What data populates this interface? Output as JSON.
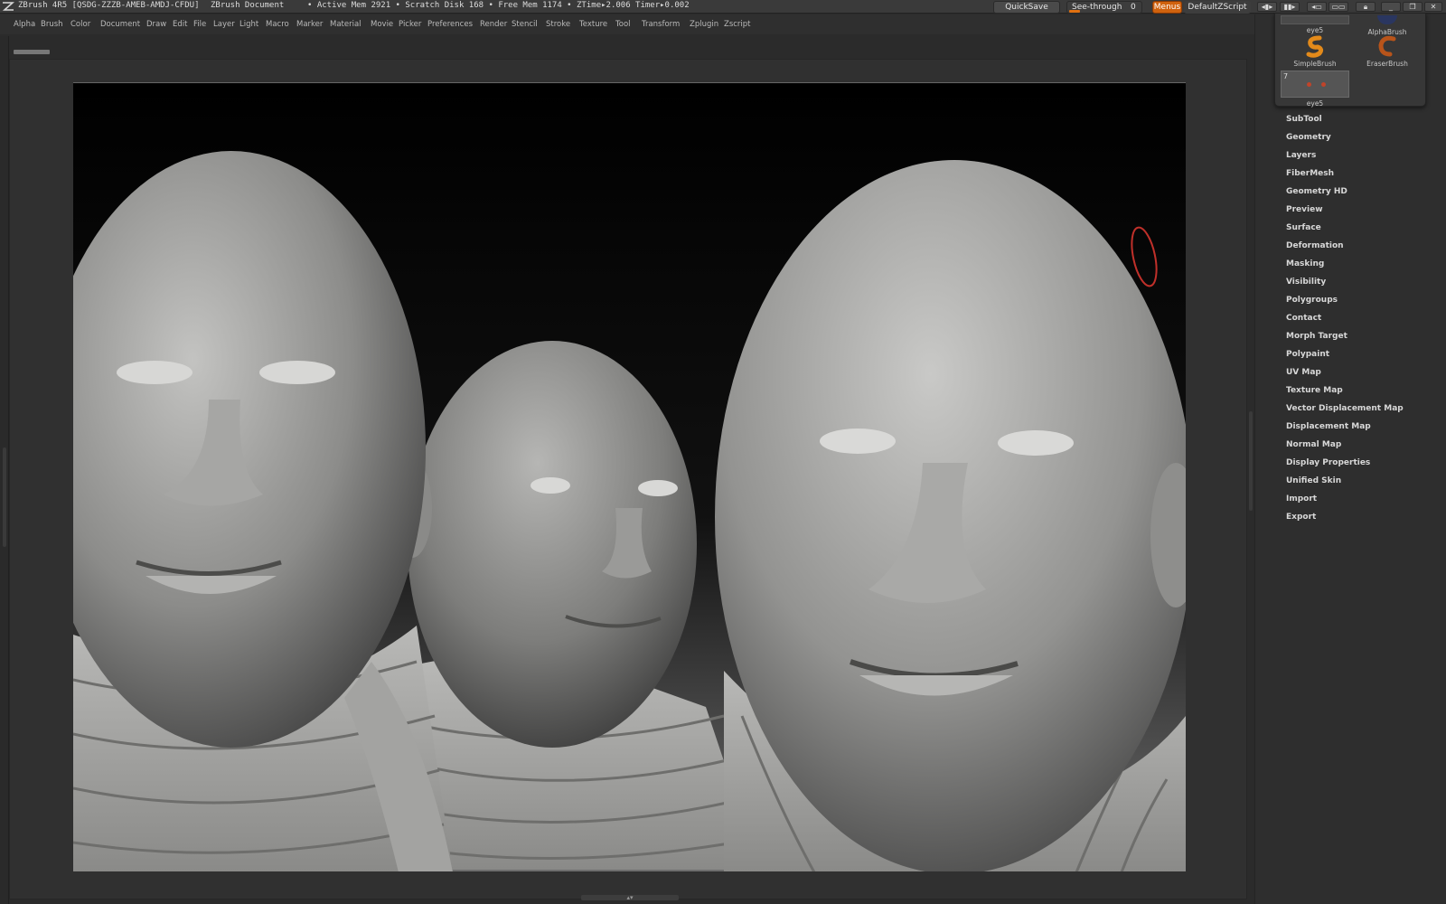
{
  "titlebar": {
    "app_title": "ZBrush 4R5 [QSDG-ZZZB-AMEB-AMDJ-CFDU]",
    "document": "ZBrush Document",
    "stats": "• Active Mem 2921 • Scratch Disk 168 • Free Mem 1174 • ZTime▸2.006 Timer▸0.002",
    "quicksave": "QuickSave",
    "seethrough_label": "See-through",
    "seethrough_value": "0",
    "seethrough_level": 0,
    "menus": "Menus",
    "default_zscript": "DefaultZScript",
    "accent_color": "#d0620e"
  },
  "menubar": {
    "items": [
      "Alpha",
      "Brush",
      "Color",
      "Document",
      "Draw",
      "Edit",
      "File",
      "Layer",
      "Light",
      "Macro",
      "Marker",
      "Material",
      "Movie",
      "Picker",
      "Preferences",
      "Render",
      "Stencil",
      "Stroke",
      "Texture",
      "Tool",
      "Transform",
      "Zplugin",
      "Zscript"
    ]
  },
  "brush_popup": {
    "thumb_top_label": "eye5",
    "alpha_brush": "AlphaBrush",
    "simple_brush": "SimpleBrush",
    "eraser_brush": "EraserBrush",
    "eye_thumb_number": "7",
    "eye_thumb_label": "eye5"
  },
  "tool_palette": {
    "items": [
      "SubTool",
      "Geometry",
      "Layers",
      "FiberMesh",
      "Geometry HD",
      "Preview",
      "Surface",
      "Deformation",
      "Masking",
      "Visibility",
      "Polygroups",
      "Contact",
      "Morph Target",
      "Polypaint",
      "UV Map",
      "Texture Map",
      "Vector Displacement Map",
      "Displacement Map",
      "Normal Map",
      "Display Properties",
      "Unified Skin",
      "Import",
      "Export"
    ]
  },
  "canvas": {
    "content": "Three sculpted bald male head busts in grey clay material",
    "brush_cursor_color": "#c0302a"
  }
}
